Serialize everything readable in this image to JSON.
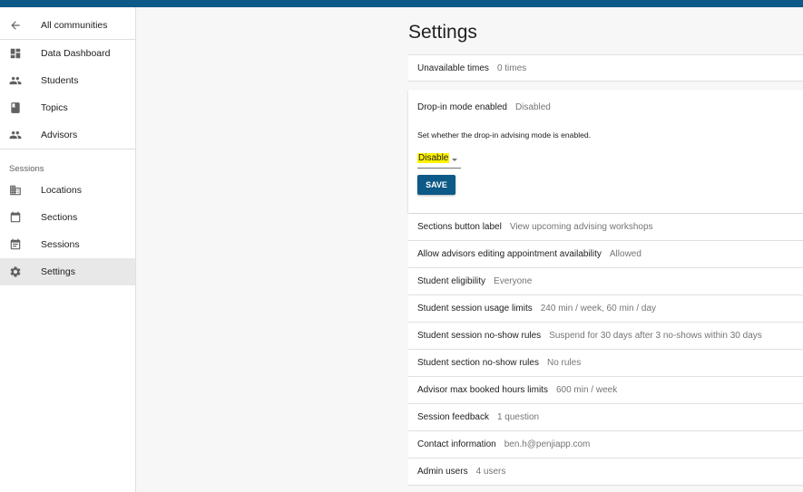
{
  "colors": {
    "brand": "#0d5987",
    "highlight": "#fff200"
  },
  "sidebar": {
    "back": {
      "label": "All communities",
      "icon": "arrow-left-icon"
    },
    "items": [
      {
        "label": "Data Dashboard",
        "icon": "dashboard-icon"
      },
      {
        "label": "Students",
        "icon": "people-icon"
      },
      {
        "label": "Topics",
        "icon": "book-icon"
      },
      {
        "label": "Advisors",
        "icon": "people-icon"
      }
    ],
    "sessions_header": "Sessions",
    "session_items": [
      {
        "label": "Locations",
        "icon": "building-icon"
      },
      {
        "label": "Sections",
        "icon": "calendar-icon"
      },
      {
        "label": "Sessions",
        "icon": "event-note-icon"
      },
      {
        "label": "Settings",
        "icon": "gear-icon",
        "active": true
      }
    ]
  },
  "main": {
    "title": "Settings",
    "unavailable": {
      "label": "Unavailable times",
      "value": "0 times"
    },
    "dropin": {
      "label": "Drop-in mode enabled",
      "value": "Disabled",
      "description": "Set whether the drop-in advising mode is enabled.",
      "select_value": "Disable",
      "save_label": "SAVE"
    },
    "rows": [
      {
        "label": "Sections button label",
        "value": "View upcoming advising workshops"
      },
      {
        "label": "Allow advisors editing appointment availability",
        "value": "Allowed"
      },
      {
        "label": "Student eligibility",
        "value": "Everyone"
      },
      {
        "label": "Student session usage limits",
        "value": "240 min / week, 60 min / day"
      },
      {
        "label": "Student session no-show rules",
        "value": "Suspend for 30 days after 3 no-shows within 30 days"
      },
      {
        "label": "Student section no-show rules",
        "value": "No rules"
      },
      {
        "label": "Advisor max booked hours limits",
        "value": "600 min / week"
      },
      {
        "label": "Session feedback",
        "value": "1 question"
      },
      {
        "label": "Contact information",
        "value": "ben.h@penjiapp.com"
      },
      {
        "label": "Admin users",
        "value": "4 users"
      }
    ]
  }
}
